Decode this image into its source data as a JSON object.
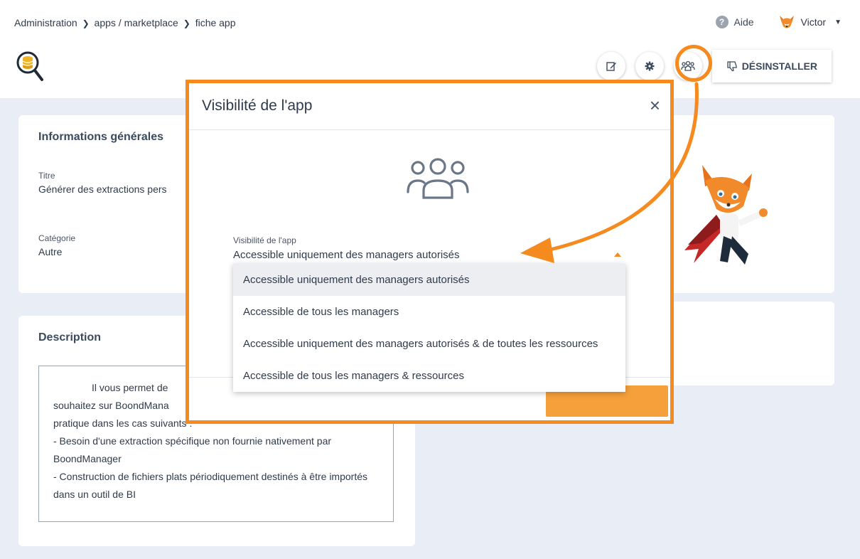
{
  "breadcrumb": {
    "items": [
      "Administration",
      "apps / marketplace",
      "fiche app"
    ],
    "separator": ">"
  },
  "header": {
    "help_label": "Aide",
    "help_icon": "?",
    "user_name": "Victor"
  },
  "toolbar": {
    "edit_icon": "edit-icon",
    "settings_icon": "gear-icon",
    "visibility_icon": "users-icon",
    "uninstall_label": "DÉSINSTALLER"
  },
  "info_card": {
    "title": "Informations générales",
    "title_field_label": "Titre",
    "title_field_value": "Générer des extractions pers",
    "category_label": "Catégorie",
    "category_value": "Autre"
  },
  "description_card": {
    "title": "Description",
    "lines": [
      "Il vous permet de",
      "souhaitez sur BoondMana",
      "pratique dans les cas suivants :",
      "- Besoin d'une extraction spécifique non fournie nativement par BoondManager",
      "- Construction de fichiers plats périodiquement destinés à être importés dans un outil de BI"
    ]
  },
  "modal": {
    "title": "Visibilité de l'app",
    "close_glyph": "×",
    "visibility_label": "Visibilité de l'app",
    "selected_value": "Accessible uniquement des managers autorisés",
    "options": [
      "Accessible uniquement des managers autorisés",
      "Accessible de tous les managers",
      "Accessible uniquement des managers autorisés & de toutes les ressources",
      "Accessible de tous les managers & ressources"
    ]
  },
  "colors": {
    "accent": "#f58a1f",
    "background": "#e9eef6",
    "text": "#2f3b4a"
  }
}
